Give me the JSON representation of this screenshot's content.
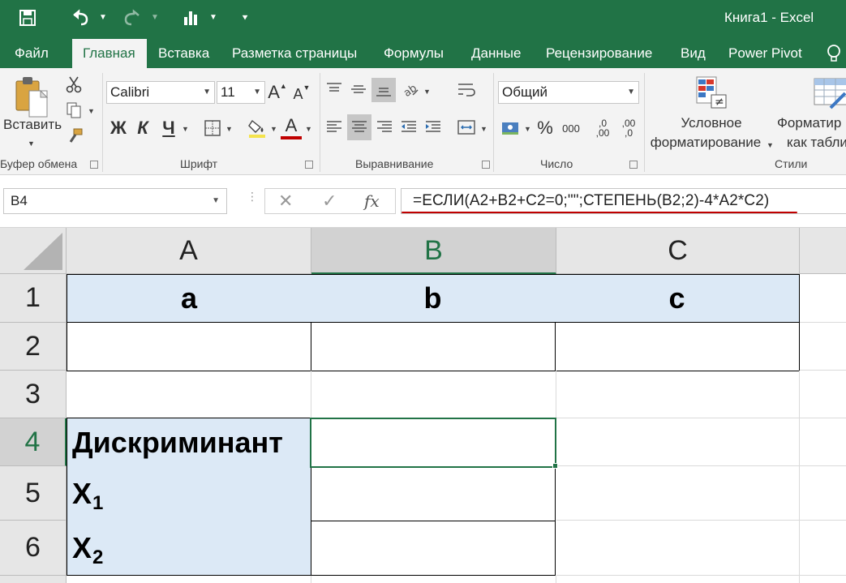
{
  "window": {
    "title": "Книга1 - Excel"
  },
  "menu": {
    "tabs": [
      {
        "label": "Файл"
      },
      {
        "label": "Главная"
      },
      {
        "label": "Вставка"
      },
      {
        "label": "Разметка страницы"
      },
      {
        "label": "Формулы"
      },
      {
        "label": "Данные"
      },
      {
        "label": "Рецензирование"
      },
      {
        "label": "Вид"
      },
      {
        "label": "Power Pivot"
      }
    ]
  },
  "ribbon": {
    "clipboard": {
      "paste_label": "Вставить",
      "group_label": "Буфер обмена"
    },
    "font": {
      "name": "Calibri",
      "size": "11",
      "bold": "Ж",
      "italic": "К",
      "underline": "Ч",
      "grow": "A",
      "shrink": "A",
      "font_color": "A",
      "group_label": "Шрифт"
    },
    "alignment": {
      "group_label": "Выравнивание"
    },
    "number": {
      "format": "Общий",
      "percent": "%",
      "thousands": "000",
      "inc_decimal": ",00",
      "dec_decimal": ",0",
      "group_label": "Число"
    },
    "styles": {
      "conditional_line1": "Условное",
      "conditional_line2": "форматирование",
      "format_table_line1": "Форматир",
      "format_table_line2": "как табли",
      "group_label": "Стили"
    }
  },
  "formula_bar": {
    "name_box": "B4",
    "fx": "fx",
    "formula": "=ЕСЛИ(A2+B2+C2=0;\"\";СТЕПЕНЬ(B2;2)-4*A2*C2)"
  },
  "sheet": {
    "columns": [
      "A",
      "B",
      "C"
    ],
    "rows": [
      "1",
      "2",
      "3",
      "4",
      "5",
      "6"
    ],
    "cells": {
      "A1": "a",
      "B1": "b",
      "C1": "c",
      "A4": "Дискриминант",
      "A5": "X",
      "A5_sub": "1",
      "A6": "X",
      "A6_sub": "2"
    },
    "selected_cell": "B4"
  },
  "colors": {
    "brand": "#217346",
    "header_fill": "#dce9f6",
    "underline_red": "#c00000"
  }
}
